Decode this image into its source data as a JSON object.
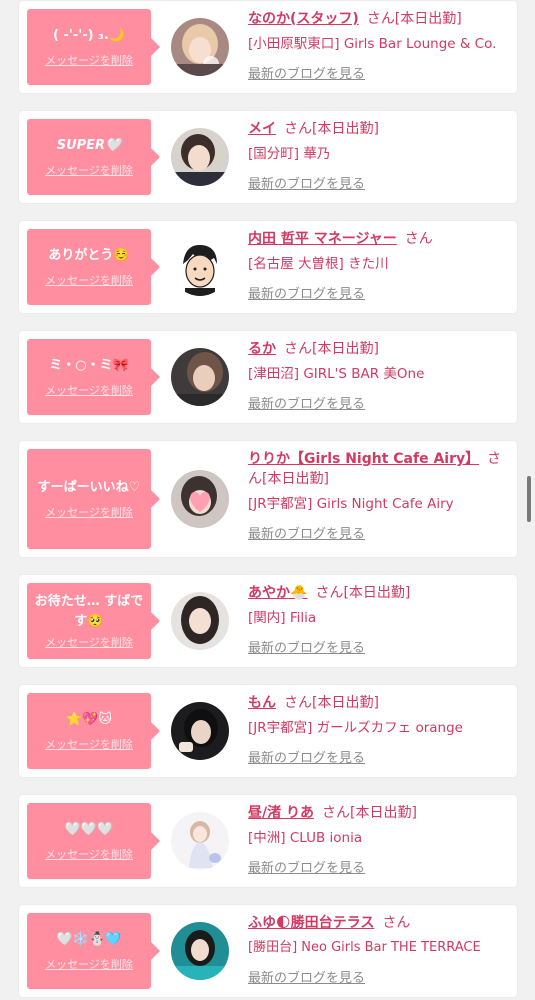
{
  "delete_label": "メッセージを削除",
  "blog_label": "最新のブログを見る",
  "san_label": "さん",
  "colors": {
    "bubble": "#ff8ea0",
    "accent": "#d23a63",
    "card": "#ffffff",
    "background": "#f1f1f1",
    "link_gray": "#8c8c8c"
  },
  "entries": [
    {
      "message": "( -'-'-) ₃.🌙",
      "name": "なのか(スタッフ)",
      "status": "[本日出勤]",
      "shop": "[小田原駅東口] Girls Bar Lounge & Co.",
      "avatar": "avatar-girl-blonde-icon"
    },
    {
      "message": "SUPER🤍",
      "name": "メイ",
      "status": "[本日出勤]",
      "shop": "[国分町] 華乃",
      "avatar": "avatar-girl-dark-hair-icon"
    },
    {
      "message": "ありがとう☺️",
      "name": "内田 哲平 マネージャー",
      "status": "",
      "shop": "[名古屋 大曽根] きた川",
      "avatar": "avatar-cartoon-man-icon"
    },
    {
      "message": "ミ・○・ミ🎀",
      "name": "るか",
      "status": "[本日出勤]",
      "shop": "[津田沼] GIRL'S BAR 美One",
      "avatar": "avatar-girl-brown-hair-icon"
    },
    {
      "message": "すーぱーいいね♡",
      "name": "りりか【Girls Night Cafe Airy】",
      "status": "[本日出勤]",
      "shop": "[JR宇都宮] Girls Night Cafe Airy",
      "avatar": "avatar-girl-heart-sticker-icon"
    },
    {
      "message": "お待たせ… すばです🥺",
      "name": "あやか🐣",
      "status": "[本日出勤]",
      "shop": "[関内] Filia",
      "avatar": "avatar-girl-long-hair-icon"
    },
    {
      "message": "⭐️💖🐱",
      "name": "もん",
      "status": "[本日出勤]",
      "shop": "[JR宇都宮] ガールズカフェ orange",
      "avatar": "avatar-girl-black-hair-icon"
    },
    {
      "message": "🤍🤍🤍",
      "name": "昼/渚 りあ",
      "status": "[本日出勤]",
      "shop": "[中洲] CLUB ionia",
      "avatar": "avatar-girl-white-dress-icon"
    },
    {
      "message": "🤍❄️☃️🩵",
      "name": "ふゆ🌓勝田台テラス",
      "status": "",
      "shop": "[勝田台] Neo Girls Bar THE TERRACE",
      "avatar": "avatar-girl-teal-background-icon"
    }
  ]
}
